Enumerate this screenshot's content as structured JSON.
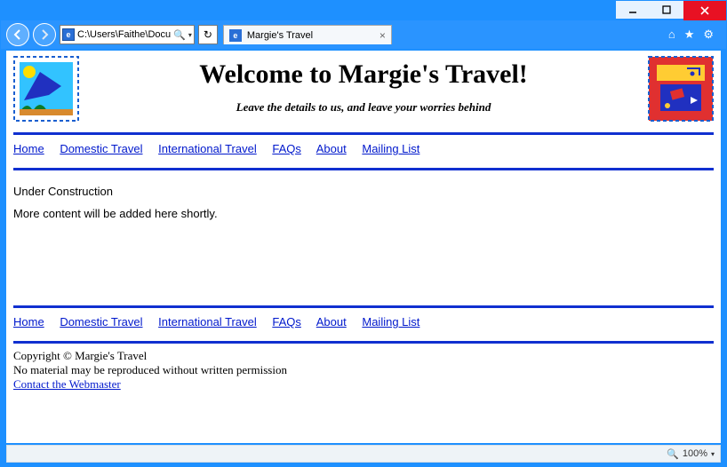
{
  "window": {
    "address_text": "C:\\Users\\Faithe\\Docu"
  },
  "tab": {
    "title": "Margie's Travel"
  },
  "page": {
    "heading": "Welcome to Margie's Travel!",
    "tagline": "Leave the details to us, and leave your worries behind",
    "nav": {
      "home": "Home",
      "domestic": "Domestic Travel",
      "international": "International Travel",
      "faqs": "FAQs",
      "about": "About",
      "mailing": "Mailing List"
    },
    "body": {
      "under_construction": "Under Construction",
      "more_content": "More content will be added here shortly."
    },
    "footer": {
      "copyright": "Copyright © Margie's Travel",
      "no_material": "No material may be reproduced without written permission",
      "contact_label": "Contact the Webmaster"
    }
  },
  "status": {
    "zoom": "100%"
  }
}
